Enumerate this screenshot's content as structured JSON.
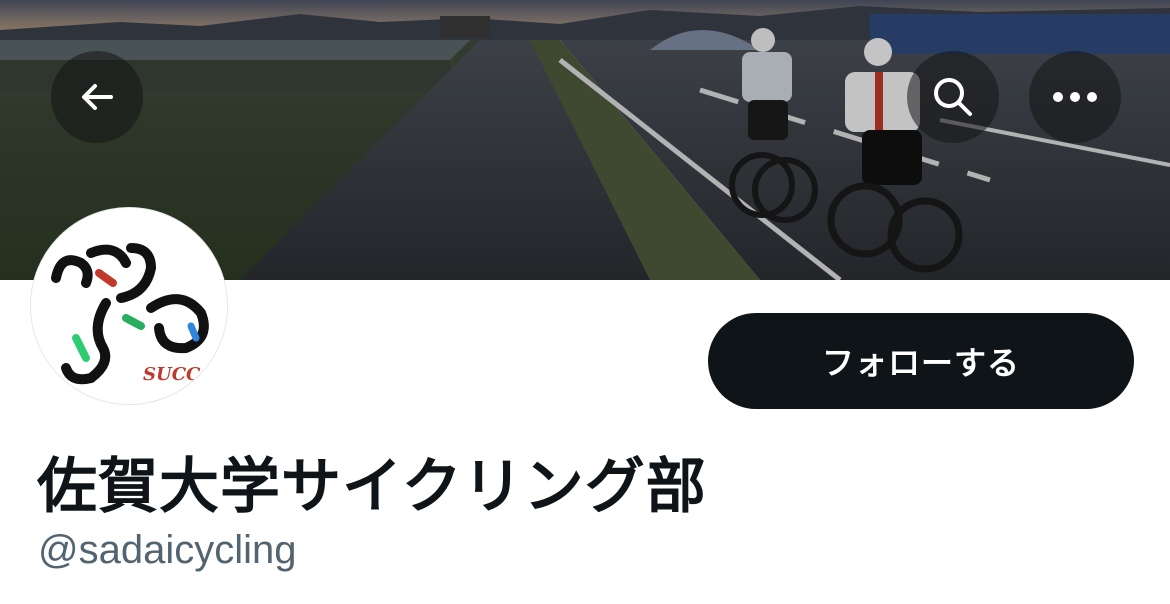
{
  "header": {
    "back_icon": "arrow-left-icon",
    "search_icon": "search-icon",
    "more_icon": "more-horizontal-icon"
  },
  "banner": {
    "description": "cyclists riding on a road at dusk"
  },
  "avatar": {
    "logo_text": "SUCC"
  },
  "profile": {
    "display_name": "佐賀大学サイクリング部",
    "handle": "@sadaicycling",
    "follow_label": "フォローする"
  },
  "colors": {
    "button_bg": "#0f1419",
    "handle_text": "#536471"
  }
}
